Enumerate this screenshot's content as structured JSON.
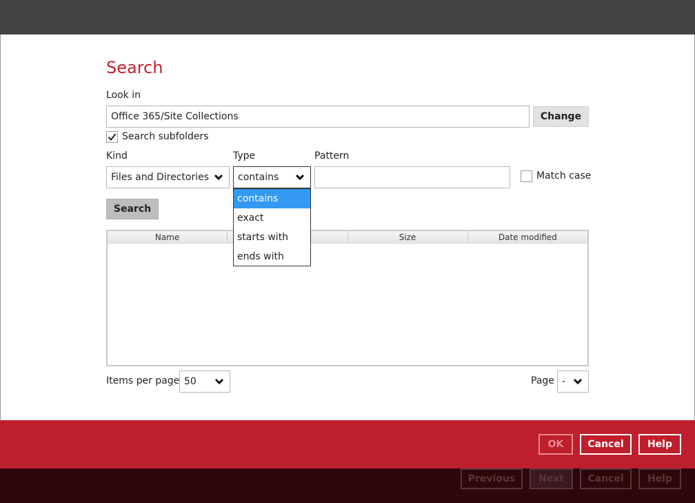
{
  "dialog": {
    "title": "Search",
    "look_in_label": "Look in",
    "look_in_value": "Office 365/Site Collections",
    "change_label": "Change",
    "subfolders_label": "Search subfolders",
    "subfolders_checked": true
  },
  "filters": {
    "kind_label": "Kind",
    "kind_value": "Files and Directories",
    "type_label": "Type",
    "type_value": "contains",
    "type_options": [
      "contains",
      "exact",
      "starts with",
      "ends with"
    ],
    "pattern_label": "Pattern",
    "pattern_value": "",
    "match_case_label": "Match case",
    "match_case_checked": false,
    "search_label": "Search"
  },
  "results_table": {
    "columns": [
      "Name",
      "",
      "Size",
      "Date modified"
    ]
  },
  "paging": {
    "items_per_page_label": "Items per page",
    "items_per_page_value": "50",
    "page_label": "Page",
    "page_value": "-"
  },
  "footer": {
    "ok_label": "OK",
    "cancel_label": "Cancel",
    "help_label": "Help"
  },
  "wizard_footer": {
    "previous_label": "Previous",
    "next_label": "Next",
    "cancel_label": "Cancel",
    "help_label": "Help"
  },
  "colors": {
    "accent": "#c0232e",
    "footer_red": "#bf1e2d",
    "footer_dark": "#2f060c",
    "selection_blue": "#3399f3"
  }
}
